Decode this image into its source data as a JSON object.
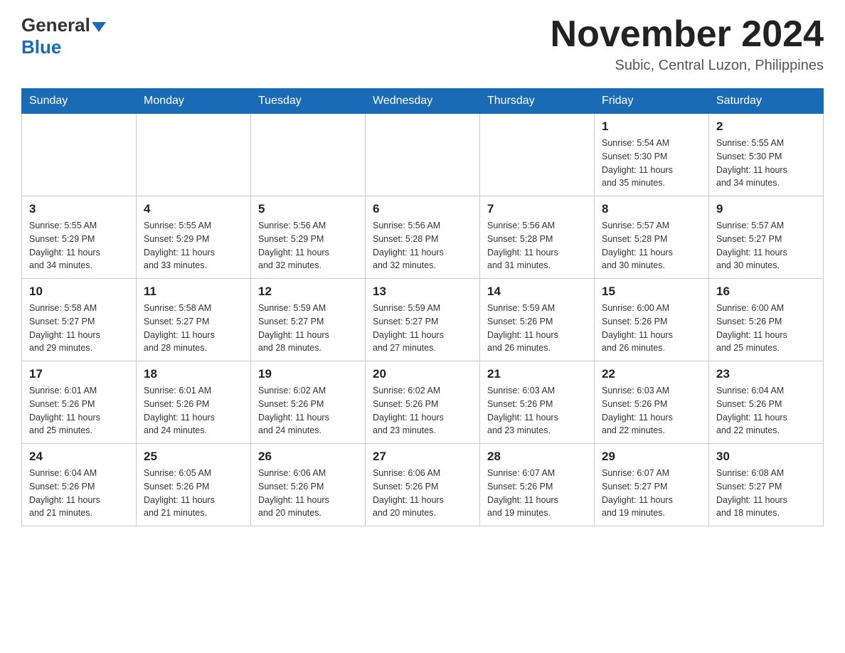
{
  "header": {
    "logo_general": "General",
    "logo_blue": "Blue",
    "month_title": "November 2024",
    "subtitle": "Subic, Central Luzon, Philippines"
  },
  "days_of_week": [
    "Sunday",
    "Monday",
    "Tuesday",
    "Wednesday",
    "Thursday",
    "Friday",
    "Saturday"
  ],
  "weeks": [
    [
      {
        "day": "",
        "info": ""
      },
      {
        "day": "",
        "info": ""
      },
      {
        "day": "",
        "info": ""
      },
      {
        "day": "",
        "info": ""
      },
      {
        "day": "",
        "info": ""
      },
      {
        "day": "1",
        "info": "Sunrise: 5:54 AM\nSunset: 5:30 PM\nDaylight: 11 hours\nand 35 minutes."
      },
      {
        "day": "2",
        "info": "Sunrise: 5:55 AM\nSunset: 5:30 PM\nDaylight: 11 hours\nand 34 minutes."
      }
    ],
    [
      {
        "day": "3",
        "info": "Sunrise: 5:55 AM\nSunset: 5:29 PM\nDaylight: 11 hours\nand 34 minutes."
      },
      {
        "day": "4",
        "info": "Sunrise: 5:55 AM\nSunset: 5:29 PM\nDaylight: 11 hours\nand 33 minutes."
      },
      {
        "day": "5",
        "info": "Sunrise: 5:56 AM\nSunset: 5:29 PM\nDaylight: 11 hours\nand 32 minutes."
      },
      {
        "day": "6",
        "info": "Sunrise: 5:56 AM\nSunset: 5:28 PM\nDaylight: 11 hours\nand 32 minutes."
      },
      {
        "day": "7",
        "info": "Sunrise: 5:56 AM\nSunset: 5:28 PM\nDaylight: 11 hours\nand 31 minutes."
      },
      {
        "day": "8",
        "info": "Sunrise: 5:57 AM\nSunset: 5:28 PM\nDaylight: 11 hours\nand 30 minutes."
      },
      {
        "day": "9",
        "info": "Sunrise: 5:57 AM\nSunset: 5:27 PM\nDaylight: 11 hours\nand 30 minutes."
      }
    ],
    [
      {
        "day": "10",
        "info": "Sunrise: 5:58 AM\nSunset: 5:27 PM\nDaylight: 11 hours\nand 29 minutes."
      },
      {
        "day": "11",
        "info": "Sunrise: 5:58 AM\nSunset: 5:27 PM\nDaylight: 11 hours\nand 28 minutes."
      },
      {
        "day": "12",
        "info": "Sunrise: 5:59 AM\nSunset: 5:27 PM\nDaylight: 11 hours\nand 28 minutes."
      },
      {
        "day": "13",
        "info": "Sunrise: 5:59 AM\nSunset: 5:27 PM\nDaylight: 11 hours\nand 27 minutes."
      },
      {
        "day": "14",
        "info": "Sunrise: 5:59 AM\nSunset: 5:26 PM\nDaylight: 11 hours\nand 26 minutes."
      },
      {
        "day": "15",
        "info": "Sunrise: 6:00 AM\nSunset: 5:26 PM\nDaylight: 11 hours\nand 26 minutes."
      },
      {
        "day": "16",
        "info": "Sunrise: 6:00 AM\nSunset: 5:26 PM\nDaylight: 11 hours\nand 25 minutes."
      }
    ],
    [
      {
        "day": "17",
        "info": "Sunrise: 6:01 AM\nSunset: 5:26 PM\nDaylight: 11 hours\nand 25 minutes."
      },
      {
        "day": "18",
        "info": "Sunrise: 6:01 AM\nSunset: 5:26 PM\nDaylight: 11 hours\nand 24 minutes."
      },
      {
        "day": "19",
        "info": "Sunrise: 6:02 AM\nSunset: 5:26 PM\nDaylight: 11 hours\nand 24 minutes."
      },
      {
        "day": "20",
        "info": "Sunrise: 6:02 AM\nSunset: 5:26 PM\nDaylight: 11 hours\nand 23 minutes."
      },
      {
        "day": "21",
        "info": "Sunrise: 6:03 AM\nSunset: 5:26 PM\nDaylight: 11 hours\nand 23 minutes."
      },
      {
        "day": "22",
        "info": "Sunrise: 6:03 AM\nSunset: 5:26 PM\nDaylight: 11 hours\nand 22 minutes."
      },
      {
        "day": "23",
        "info": "Sunrise: 6:04 AM\nSunset: 5:26 PM\nDaylight: 11 hours\nand 22 minutes."
      }
    ],
    [
      {
        "day": "24",
        "info": "Sunrise: 6:04 AM\nSunset: 5:26 PM\nDaylight: 11 hours\nand 21 minutes."
      },
      {
        "day": "25",
        "info": "Sunrise: 6:05 AM\nSunset: 5:26 PM\nDaylight: 11 hours\nand 21 minutes."
      },
      {
        "day": "26",
        "info": "Sunrise: 6:06 AM\nSunset: 5:26 PM\nDaylight: 11 hours\nand 20 minutes."
      },
      {
        "day": "27",
        "info": "Sunrise: 6:06 AM\nSunset: 5:26 PM\nDaylight: 11 hours\nand 20 minutes."
      },
      {
        "day": "28",
        "info": "Sunrise: 6:07 AM\nSunset: 5:26 PM\nDaylight: 11 hours\nand 19 minutes."
      },
      {
        "day": "29",
        "info": "Sunrise: 6:07 AM\nSunset: 5:27 PM\nDaylight: 11 hours\nand 19 minutes."
      },
      {
        "day": "30",
        "info": "Sunrise: 6:08 AM\nSunset: 5:27 PM\nDaylight: 11 hours\nand 18 minutes."
      }
    ]
  ]
}
